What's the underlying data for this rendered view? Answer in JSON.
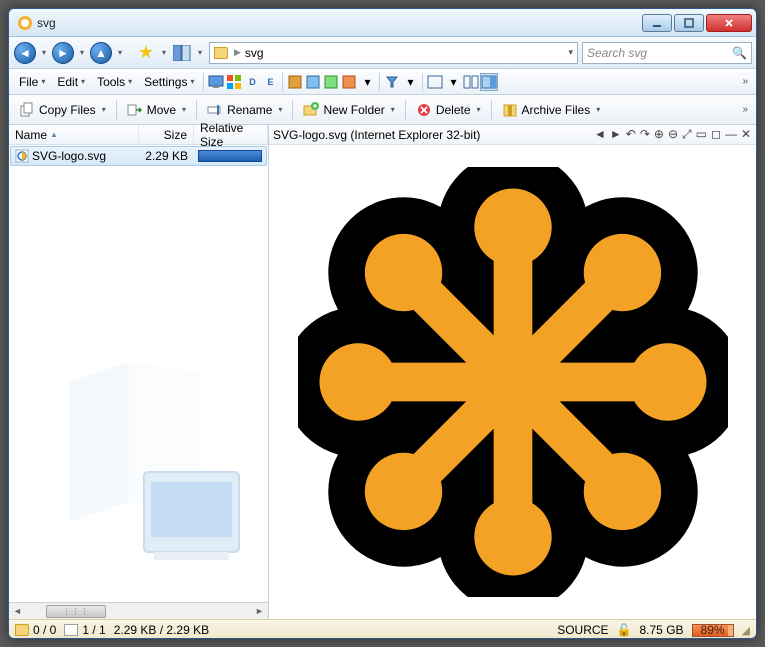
{
  "window": {
    "title": "svg"
  },
  "nav": {
    "path_segment": "svg",
    "search_placeholder": "Search svg"
  },
  "menus": {
    "file": "File",
    "edit": "Edit",
    "tools": "Tools",
    "settings": "Settings"
  },
  "toolbar_labels": {
    "d": "D",
    "e": "E"
  },
  "actions": {
    "copy": "Copy Files",
    "move": "Move",
    "rename": "Rename",
    "new_folder": "New Folder",
    "delete": "Delete",
    "archive": "Archive Files"
  },
  "columns": {
    "name": "Name",
    "size": "Size",
    "rel": "Relative Size"
  },
  "files": [
    {
      "name": "SVG-logo.svg",
      "size": "2.29 KB",
      "rel_pct": 100
    }
  ],
  "preview": {
    "title": "SVG-logo.svg (Internet Explorer 32-bit)"
  },
  "status": {
    "folders": "0 / 0",
    "files": "1 / 1",
    "sizes": "2.29 KB / 2.29 KB",
    "source_label": "SOURCE",
    "disk_free": "8.75 GB",
    "disk_pct": "89%"
  }
}
